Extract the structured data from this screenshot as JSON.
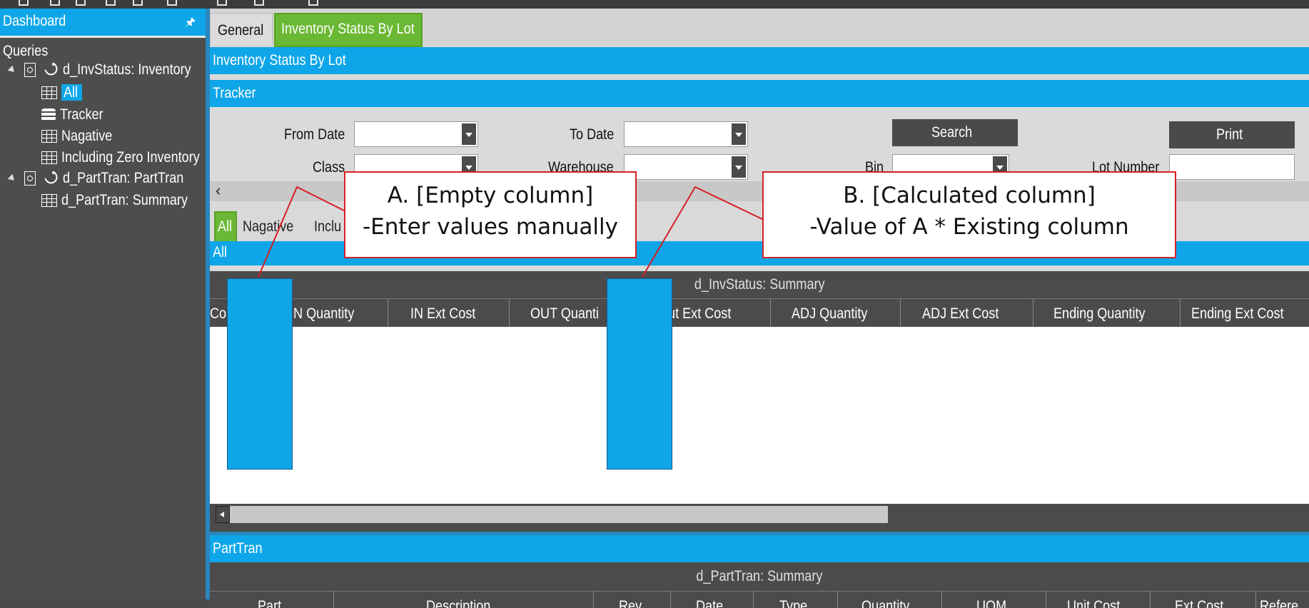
{
  "sidebar": {
    "title": "Dashboard",
    "section": "Queries",
    "tree": [
      {
        "label": "d_InvStatus: Inventory",
        "level": 0
      },
      {
        "label": "All",
        "level": 1,
        "selected": true
      },
      {
        "label": "Tracker",
        "level": 1
      },
      {
        "label": "Nagative",
        "level": 1
      },
      {
        "label": "Including Zero Inventory",
        "level": 1
      },
      {
        "label": "d_PartTran: PartTran",
        "level": 0
      },
      {
        "label": "d_PartTran: Summary",
        "level": 1
      }
    ]
  },
  "tabs": [
    {
      "label": "General",
      "active": false
    },
    {
      "label": "Inventory Status By Lot",
      "active": true
    }
  ],
  "bars": {
    "section_title": "Inventory Status By Lot",
    "tracker": "Tracker",
    "subtab_header": "All",
    "parttran": "PartTran"
  },
  "form": {
    "from_date_label": "From Date",
    "to_date_label": "To Date",
    "class_label": "Class",
    "warehouse_label": "Warehouse",
    "bin_label": "Bin",
    "lot_number_label": "Lot Number",
    "search_label": "Search",
    "print_label": "Print"
  },
  "subtabs": [
    "All",
    "Nagative",
    "Inclu"
  ],
  "grid1": {
    "title": "d_InvStatus: Summary",
    "columns": [
      "Co",
      "IN Quantity",
      "IN Ext Cost",
      "OUT Quanti",
      "Out Ext Cost",
      "ADJ Quantity",
      "ADJ Ext Cost",
      "Ending Quantity",
      "Ending Ext Cost"
    ]
  },
  "grid2": {
    "title": "d_PartTran: Summary",
    "columns": [
      "Part",
      "Description",
      "Rev",
      "Date",
      "Type",
      "Quantity",
      "UOM",
      "Unit Cost",
      "Ext Cost",
      "Refere"
    ]
  },
  "annotations": {
    "a_line1": "A. [Empty column]",
    "a_line2": "-Enter values manually",
    "b_line1": "B. [Calculated column]",
    "b_line2": "-Value of A * Existing column",
    "color_border": "#d61f26",
    "color_block": "#0ea6e8"
  }
}
